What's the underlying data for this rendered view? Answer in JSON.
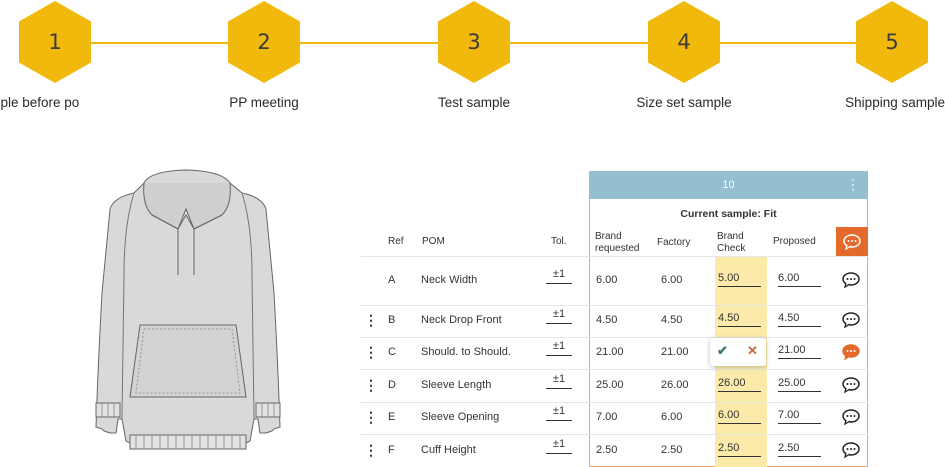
{
  "steps": [
    {
      "number": "1",
      "label": "sample before po"
    },
    {
      "number": "2",
      "label": "PP meeting"
    },
    {
      "number": "3",
      "label": "Test sample"
    },
    {
      "number": "4",
      "label": "Size set sample"
    },
    {
      "number": "5",
      "label": "Shipping sample"
    }
  ],
  "colors": {
    "step_accent": "#f0b90b",
    "size_header": "#94bfd1",
    "sample_border": "#f0a36b",
    "brand_check_fill": "#fbeaa9",
    "comment_active": "#e36a2a"
  },
  "table": {
    "size_header": "10",
    "size_menu_icon": "kebab-icon",
    "current_sample": "Current sample: Fit",
    "columns": {
      "ref": "Ref",
      "pom": "POM",
      "tol": "Tol.",
      "brand_requested_1": "Brand",
      "brand_requested_2": "requested",
      "factory": "Factory",
      "brand_check_1": "Brand",
      "brand_check_2": "Check",
      "proposed": "Proposed"
    },
    "rows": [
      {
        "ref": "A",
        "pom": "Neck Width",
        "tol": "±1",
        "brand_requested": "6.00",
        "factory": "6.00",
        "brand_check": "5.00",
        "proposed": "6.00"
      },
      {
        "ref": "B",
        "pom": "Neck Drop Front",
        "tol": "±1",
        "brand_requested": "4.50",
        "factory": "4.50",
        "brand_check": "4.50",
        "proposed": "4.50"
      },
      {
        "ref": "C",
        "pom": "Should. to Should.",
        "tol": "±1",
        "brand_requested": "21.00",
        "factory": "21.00",
        "brand_check": "",
        "proposed": "21.00"
      },
      {
        "ref": "D",
        "pom": "Sleeve Length",
        "tol": "±1",
        "brand_requested": "25.00",
        "factory": "26.00",
        "brand_check": "26.00",
        "proposed": "25.00"
      },
      {
        "ref": "E",
        "pom": "Sleeve Opening",
        "tol": "±1",
        "brand_requested": "7.00",
        "factory": "6.00",
        "brand_check": "6.00",
        "proposed": "7.00"
      },
      {
        "ref": "F",
        "pom": "Cuff Height",
        "tol": "±1",
        "brand_requested": "2.50",
        "factory": "2.50",
        "brand_check": "2.50",
        "proposed": "2.50"
      }
    ]
  },
  "popup": {
    "accept_icon": "check-icon",
    "reject_icon": "close-icon"
  }
}
